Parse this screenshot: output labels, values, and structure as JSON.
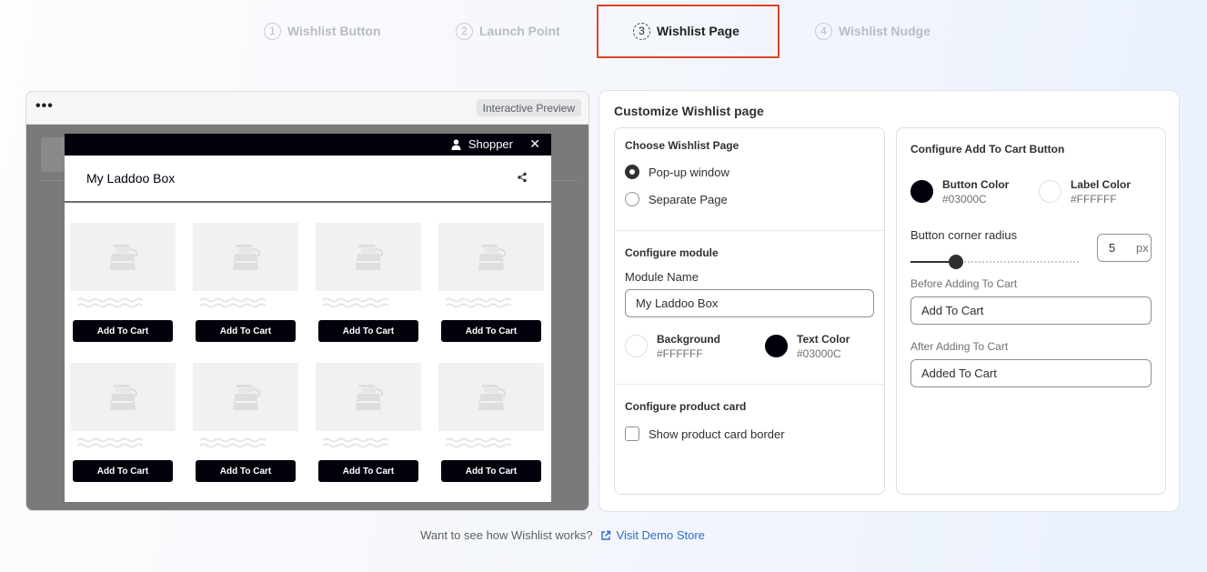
{
  "steps": [
    {
      "num": "1",
      "label": "Wishlist Button"
    },
    {
      "num": "2",
      "label": "Launch Point"
    },
    {
      "num": "3",
      "label": "Wishlist Page"
    },
    {
      "num": "4",
      "label": "Wishlist Nudge"
    }
  ],
  "active_step": 3,
  "preview": {
    "badge": "Interactive Preview",
    "topbar_user": "Shopper",
    "module_title": "My Laddoo Box",
    "add_to_cart_label": "Add To Cart",
    "product_count": 8
  },
  "customize": {
    "title": "Customize Wishlist page",
    "choose_page": {
      "heading": "Choose Wishlist Page",
      "options": [
        "Pop-up window",
        "Separate Page"
      ],
      "selected": "Pop-up window"
    },
    "module": {
      "heading": "Configure module",
      "name_label": "Module Name",
      "name_value": "My Laddoo Box",
      "background": {
        "label": "Background",
        "hex": "#FFFFFF"
      },
      "text_color": {
        "label": "Text Color",
        "hex": "#03000C"
      }
    },
    "product_card": {
      "heading": "Configure product card",
      "border_label": "Show product card border",
      "border_checked": false
    },
    "add_to_cart": {
      "heading": "Configure Add To Cart Button",
      "button_color": {
        "label": "Button Color",
        "hex": "#03000C"
      },
      "label_color": {
        "label": "Label Color",
        "hex": "#FFFFFF"
      },
      "radius_label": "Button corner radius",
      "radius_value": "5",
      "radius_unit": "px",
      "radius_fraction": 0.27,
      "before_label": "Before Adding To Cart",
      "before_value": "Add To Cart",
      "after_label": "After Adding To Cart",
      "after_value": "Added To Cart"
    }
  },
  "footer": {
    "question": "Want to see how Wishlist works?",
    "link": "Visit Demo Store"
  },
  "colors": {
    "accent": "#2c6ecb",
    "highlight": "#e0422b",
    "brand_dark": "#03000C"
  },
  "icons": [
    "more-dots-icon",
    "user-icon",
    "close-icon",
    "share-icon",
    "teapot-placeholder-icon",
    "external-link-icon"
  ]
}
